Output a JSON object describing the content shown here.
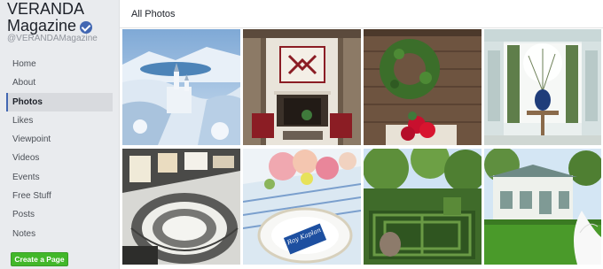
{
  "page": {
    "name_line1": "VERANDA",
    "name_line2": "Magazine",
    "handle": "@VERANDAMagazine"
  },
  "nav": {
    "items": [
      {
        "label": "Home",
        "active": false
      },
      {
        "label": "About",
        "active": false
      },
      {
        "label": "Photos",
        "active": true
      },
      {
        "label": "Likes",
        "active": false
      },
      {
        "label": "Viewpoint",
        "active": false
      },
      {
        "label": "Videos",
        "active": false
      },
      {
        "label": "Events",
        "active": false
      },
      {
        "label": "Free Stuff",
        "active": false
      },
      {
        "label": "Posts",
        "active": false
      },
      {
        "label": "Notes",
        "active": false
      }
    ]
  },
  "create_page_label": "Create a Page",
  "main": {
    "section_title": "All Photos",
    "photos": [
      {
        "name": "photo-snowy-castle"
      },
      {
        "name": "photo-fireplace-living-room"
      },
      {
        "name": "photo-boxwood-wreath"
      },
      {
        "name": "photo-green-drapes-room"
      },
      {
        "name": "photo-spiral-staircase"
      },
      {
        "name": "photo-place-setting",
        "place_card": "Roy Kaplan"
      },
      {
        "name": "photo-parterre-garden"
      },
      {
        "name": "photo-cottage-peacock"
      }
    ]
  },
  "colors": {
    "brand_blue": "#4267b2",
    "create_green": "#42b72a"
  }
}
